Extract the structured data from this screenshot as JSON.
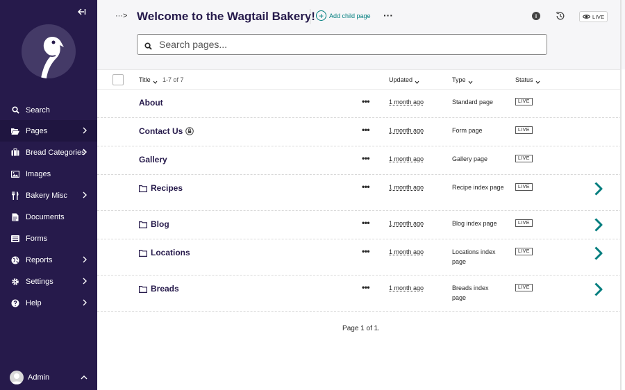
{
  "sidebar": {
    "items": [
      {
        "label": "Search",
        "icon": "search-icon",
        "chevron": false
      },
      {
        "label": "Pages",
        "icon": "folder-open-icon",
        "chevron": true,
        "active": true
      },
      {
        "label": "Bread Categories",
        "icon": "suitcase-icon",
        "chevron": true
      },
      {
        "label": "Images",
        "icon": "image-icon",
        "chevron": false
      },
      {
        "label": "Bakery Misc",
        "icon": "utensils-icon",
        "chevron": true
      },
      {
        "label": "Documents",
        "icon": "document-icon",
        "chevron": false
      },
      {
        "label": "Forms",
        "icon": "list-icon",
        "chevron": false
      },
      {
        "label": "Reports",
        "icon": "globe-icon",
        "chevron": true
      },
      {
        "label": "Settings",
        "icon": "cog-icon",
        "chevron": true
      },
      {
        "label": "Help",
        "icon": "help-icon",
        "chevron": true
      }
    ],
    "account": {
      "name": "Admin"
    }
  },
  "header": {
    "toggle": "···>",
    "title": "Welcome to the Wagtail Bakery!",
    "add_child": "Add child page",
    "more": "···",
    "info": "i",
    "live": "LIVE"
  },
  "search": {
    "placeholder": "Search pages..."
  },
  "table": {
    "columns": {
      "title": "Title",
      "count": "1-7 of 7",
      "updated": "Updated",
      "type": "Type",
      "status": "Status"
    },
    "rows": [
      {
        "title": "About",
        "updated": "1 month ago",
        "type": "Standard page",
        "status": "LIVE",
        "folder": false,
        "lock": false,
        "children": false
      },
      {
        "title": "Contact Us",
        "updated": "1 month ago",
        "type": "Form page",
        "status": "LIVE",
        "folder": false,
        "lock": true,
        "children": false
      },
      {
        "title": "Gallery",
        "updated": "1 month ago",
        "type": "Gallery page",
        "status": "LIVE",
        "folder": false,
        "lock": false,
        "children": false
      },
      {
        "title": "Recipes",
        "updated": "1 month ago",
        "type": "Recipe index page",
        "status": "LIVE",
        "folder": true,
        "lock": false,
        "children": true
      },
      {
        "title": "Blog",
        "updated": "1 month ago",
        "type": "Blog index page",
        "status": "LIVE",
        "folder": true,
        "lock": false,
        "children": true
      },
      {
        "title": "Locations",
        "updated": "1 month ago",
        "type": "Locations index page",
        "status": "LIVE",
        "folder": true,
        "lock": false,
        "children": true
      },
      {
        "title": "Breads",
        "updated": "1 month ago",
        "type": "Breads index page",
        "status": "LIVE",
        "folder": true,
        "lock": false,
        "children": true
      }
    ],
    "pagination": "Page 1 of 1."
  },
  "colors": {
    "sidebar": "#261a4b",
    "accent": "#007d7e",
    "title": "#261a4b"
  }
}
